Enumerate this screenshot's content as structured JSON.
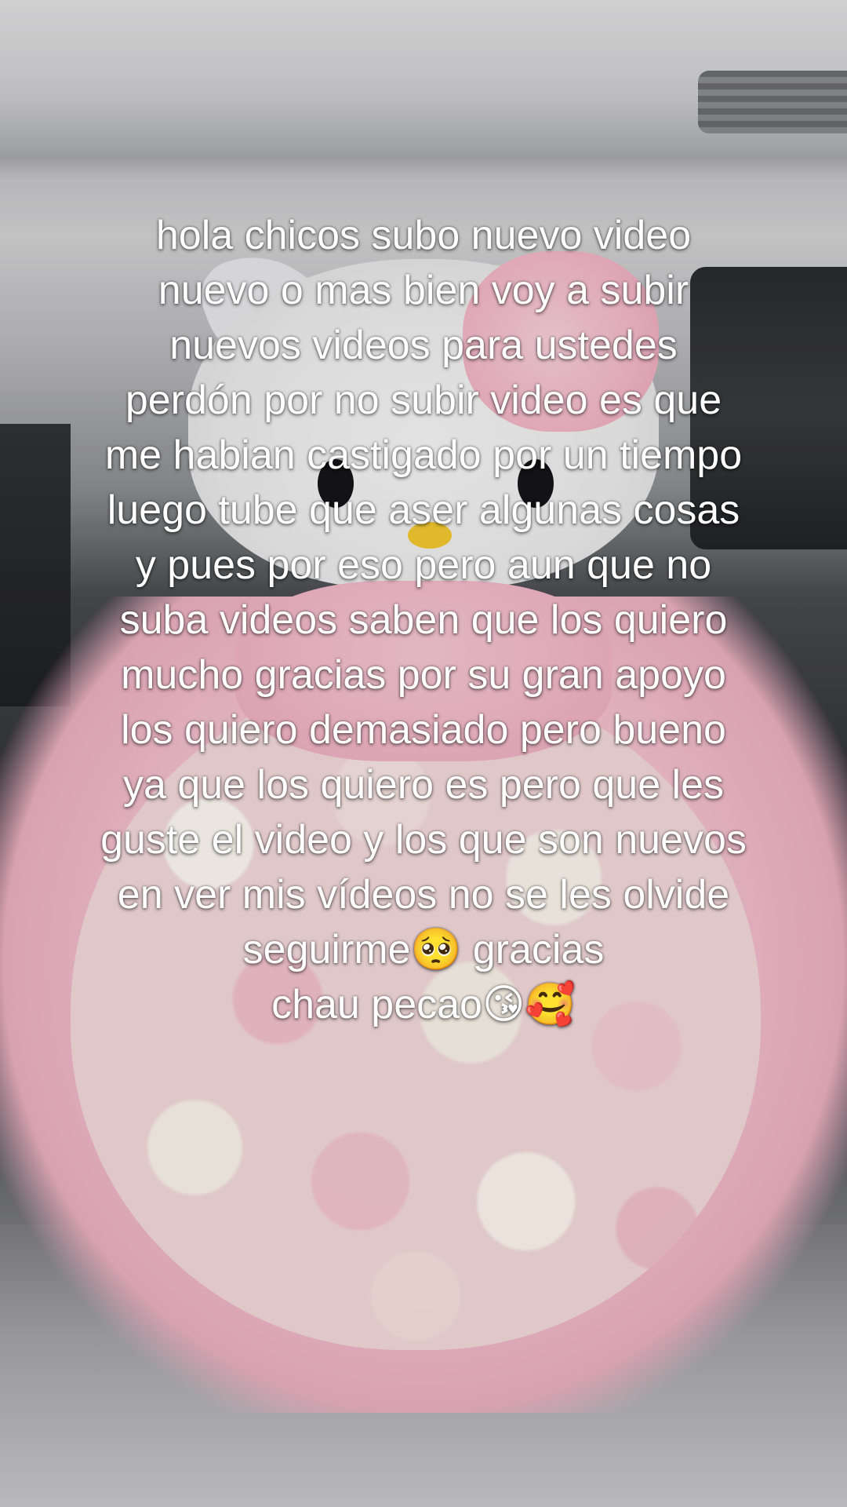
{
  "caption": {
    "lines": [
      "hola chicos subo nuevo video",
      "nuevo o mas bien voy a subir",
      "nuevos videos para ustedes",
      "perdón por no subir video es que",
      "me habian castigado por un tiempo",
      "luego tube que aser algunas cosas",
      "y pues por eso pero aun que no",
      "suba videos saben que los quiero",
      "mucho gracias por su gran apoyo",
      "los quiero demasiado pero bueno",
      "ya que los quiero es pero que les",
      "guste el video y los que son nuevos",
      "en ver mis vídeos no se les olvide",
      "seguirme🥺  gracias",
      "chau pecao😘🥰"
    ]
  },
  "scene": {
    "icons": [
      "hello-kitty-plush",
      "rose-bouquet",
      "car-dashboard",
      "car-seat"
    ],
    "colors": {
      "bouquet_pink": "#f4c3d0",
      "kitty_white": "#f6f6f6",
      "kitty_nose_yellow": "#f2c82f",
      "caption_text": "#ffffff"
    }
  }
}
